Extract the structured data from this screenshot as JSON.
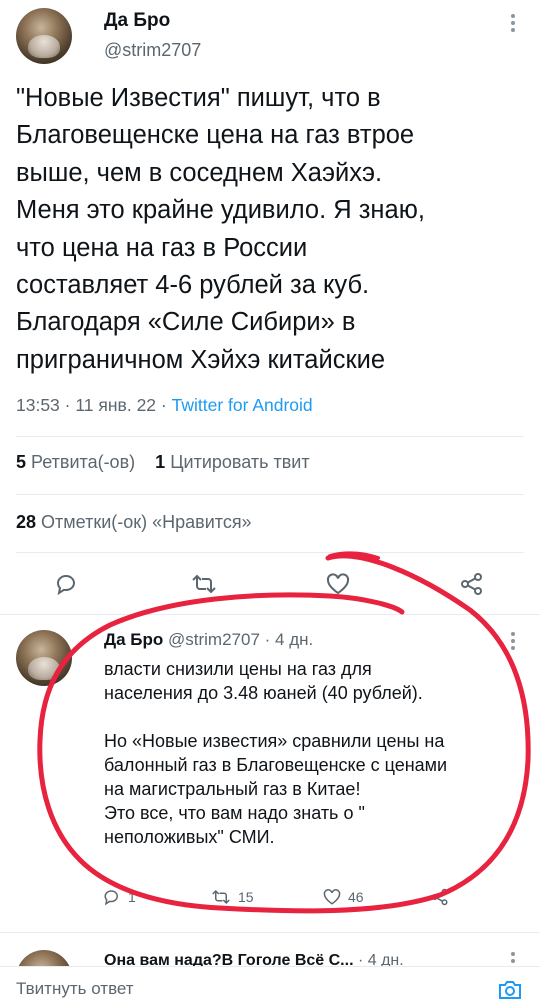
{
  "main_tweet": {
    "author_name": "Да Бро",
    "handle": "@strim2707",
    "text": "\"Новые Известия\" пишут, что в\nБлаговещенске цена на газ втрое\nвыше, чем в соседнем Хаэйхэ.\nМеня это крайне удивило. Я знаю,\nчто цена на газ в России\nсоставляет 4-6 рублей за куб.\nБлагодаря «Силе Сибири» в\nприграничном Хэйхэ китайские",
    "time": "13:53",
    "date": "11 янв. 22",
    "source": "Twitter for Android",
    "retweets_count": "5",
    "retweets_label": "Ретвита(-ов)",
    "quotes_count": "1",
    "quotes_label": "Цитировать твит",
    "likes_count": "28",
    "likes_label": "Отметки(-ок) «Нравится»"
  },
  "reply_tweet": {
    "author_name": "Да Бро",
    "handle": "@strim2707",
    "age": "4 дн.",
    "text": "власти снизили цены на газ для\nнаселения до 3.48 юаней (40 рублей).\n\nНо «Новые  известия» сравнили цены на\nбалонный газ в Благовещенске с ценами\nна магистральный газ в Китае!\nЭто все, что вам надо знать о \"\nнеположивых\" СМИ.",
    "reply_count": "1",
    "retweet_count": "15",
    "like_count": "46"
  },
  "next_tweet": {
    "author_name": "Она вам нада?В Гоголе Всё С...",
    "age": "4 дн."
  },
  "compose": {
    "placeholder": "Твитнуть ответ"
  },
  "icons": [
    "reply-icon",
    "retweet-icon",
    "like-icon",
    "share-icon",
    "more-icon",
    "camera-icon"
  ],
  "colors": {
    "accent": "#1d9bf0",
    "annotation": "#e8233f"
  }
}
